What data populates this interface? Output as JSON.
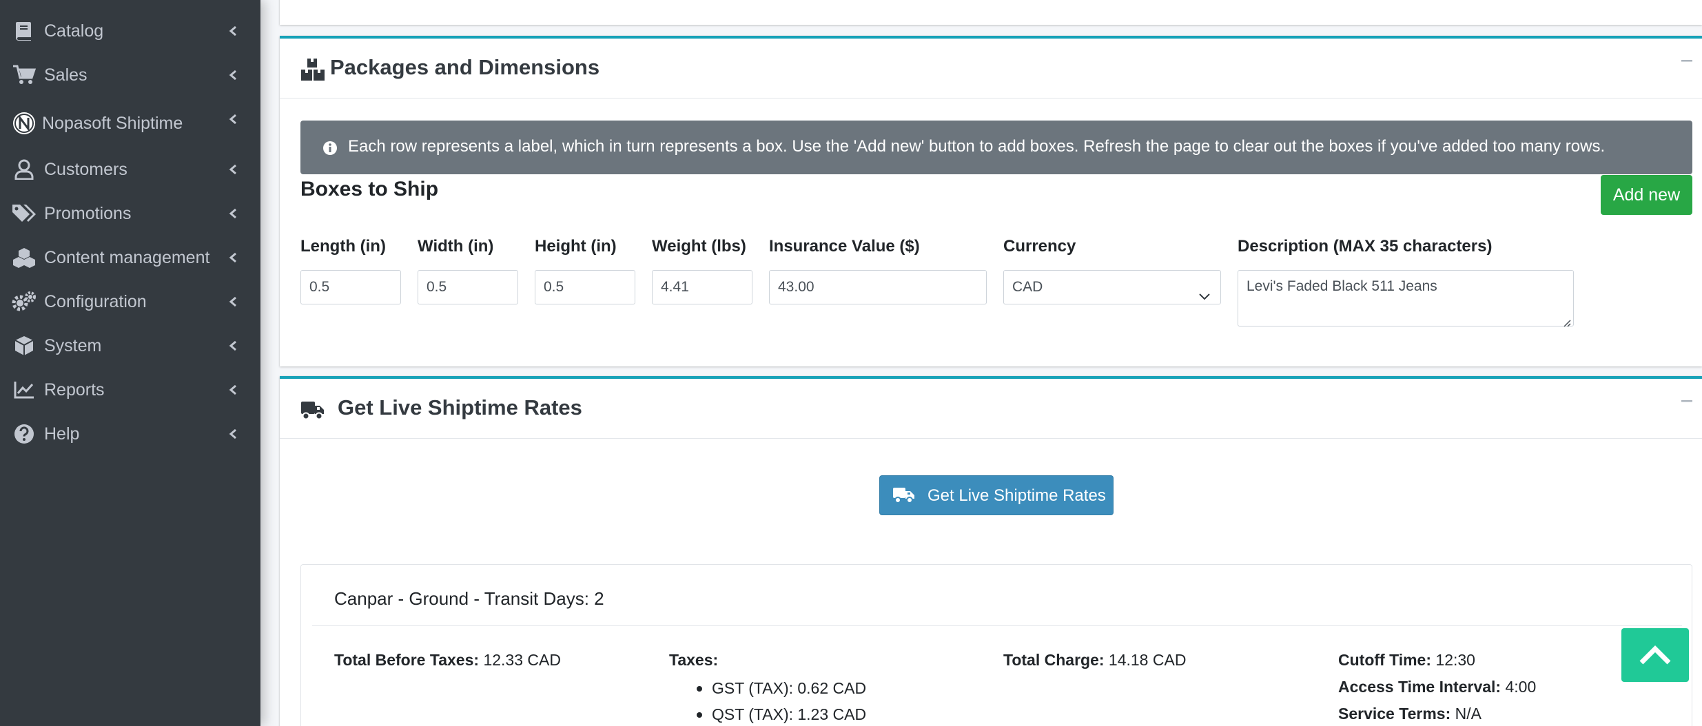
{
  "colors": {
    "sidebar_bg": "#343a40",
    "card_accent": "#17a2b8",
    "add_button": "#28a745",
    "primary_button": "#3c8dbc",
    "alert_bg": "#6c757d",
    "scroll_top_button": "#20c997"
  },
  "sidebar": {
    "items": [
      {
        "label": "Catalog",
        "icon": "book-icon"
      },
      {
        "label": "Sales",
        "icon": "shopping-cart-icon"
      },
      {
        "label": "Nopasoft Shiptime",
        "icon": "nopasoft-logo-icon"
      },
      {
        "label": "Customers",
        "icon": "user-icon"
      },
      {
        "label": "Promotions",
        "icon": "tags-icon"
      },
      {
        "label": "Content management",
        "icon": "cubes-icon"
      },
      {
        "label": "Configuration",
        "icon": "gears-icon"
      },
      {
        "label": "System",
        "icon": "cube-icon"
      },
      {
        "label": "Reports",
        "icon": "line-chart-icon"
      },
      {
        "label": "Help",
        "icon": "question-circle-icon"
      }
    ]
  },
  "packages": {
    "title": "Packages and Dimensions",
    "alert": "Each row represents a label, which in turn represents a box. Use the 'Add new' button to add boxes. Refresh the page to clear out the boxes if you've added too many rows.",
    "boxes_title": "Boxes to Ship",
    "add_new_label": "Add new",
    "fields": {
      "length": {
        "label": "Length (in)",
        "value": "0.5"
      },
      "width": {
        "label": "Width (in)",
        "value": "0.5"
      },
      "height": {
        "label": "Height (in)",
        "value": "0.5"
      },
      "weight": {
        "label": "Weight (lbs)",
        "value": "4.41"
      },
      "insurance": {
        "label": "Insurance Value ($)",
        "value": "43.00"
      },
      "currency": {
        "label": "Currency",
        "value": "CAD"
      },
      "description": {
        "label": "Description (MAX 35 characters)",
        "value": "Levi's Faded Black 511 Jeans"
      }
    }
  },
  "rates": {
    "title": "Get Live Shiptime Rates",
    "button_label": "Get Live Shiptime Rates",
    "result": {
      "title": "Canpar - Ground - Transit Days: 2",
      "total_before_taxes_label": "Total Before Taxes:",
      "total_before_taxes_value": "12.33 CAD",
      "taxes_label": "Taxes:",
      "taxes": [
        "GST (TAX): 0.62 CAD",
        "QST (TAX): 1.23 CAD"
      ],
      "total_charge_label": "Total Charge:",
      "total_charge_value": "14.18 CAD",
      "cutoff_time_label": "Cutoff Time:",
      "cutoff_time_value": "12:30",
      "access_time_label": "Access Time Interval:",
      "access_time_value": "4:00",
      "service_terms_label": "Service Terms:",
      "service_terms_value": "N/A"
    }
  }
}
